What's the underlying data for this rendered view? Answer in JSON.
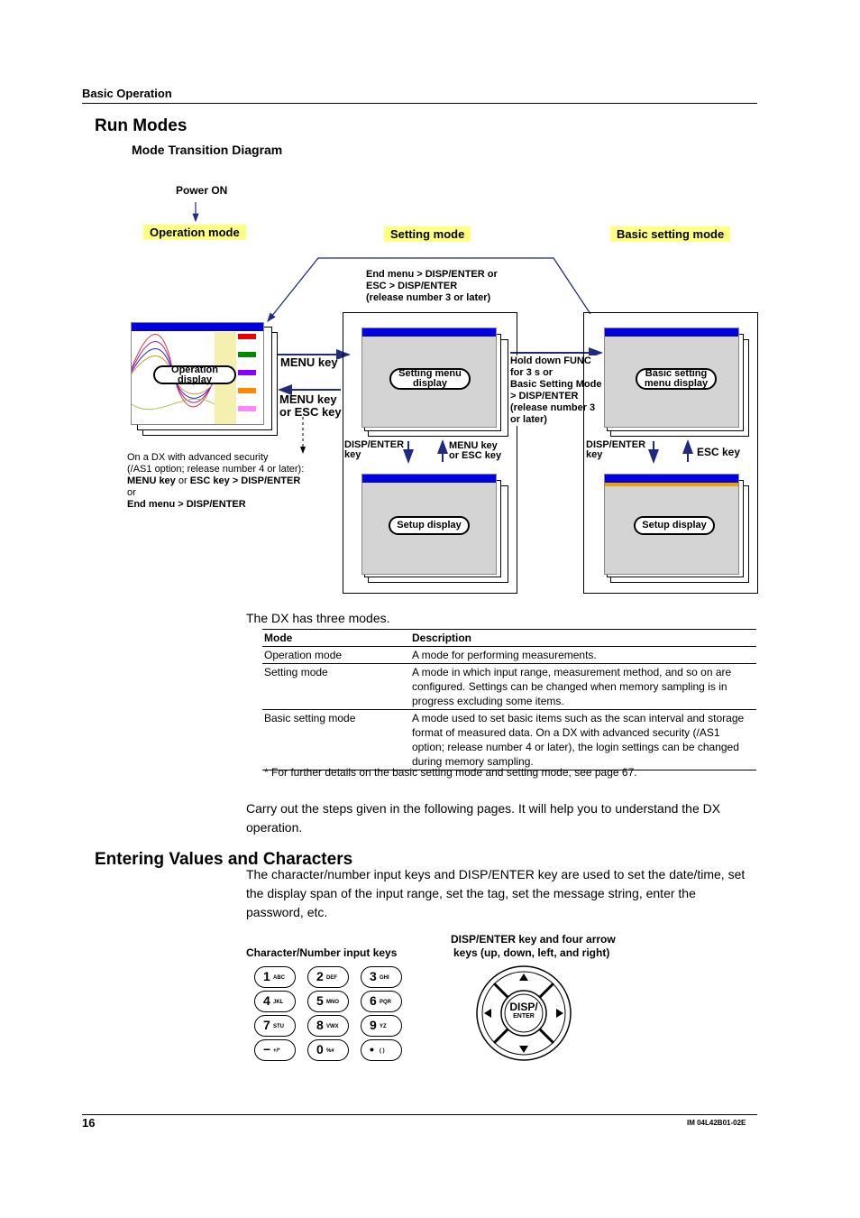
{
  "header": {
    "section": "Basic Operation"
  },
  "title": "Run Modes",
  "subtitle": "Mode Transition Diagram",
  "diagram": {
    "power_on": "Power ON",
    "modes": [
      "Operation mode",
      "Setting mode",
      "Basic setting mode"
    ],
    "return_label": [
      "End menu > DISP/ENTER or",
      "ESC > DISP/ENTER",
      "(release number 3 or later)"
    ],
    "operation_display": "Operation display",
    "setting_menu_display": "Setting menu display",
    "setup_display": "Setup display",
    "basic_setting_menu_display": "Basic setting menu display",
    "basic_setup_display": "Setup display",
    "menu_key": "MENU key",
    "menu_or_esc": [
      "MENU key",
      "or ESC key"
    ],
    "security_note": [
      "On a DX with advanced security",
      "(/AS1 option; release number 4 or later):"
    ],
    "security_keys": {
      "a": "MENU key",
      "or1": " or ",
      "b": "ESC key > DISP/ENTER",
      "or": "or",
      "c": "End menu > DISP/ENTER"
    },
    "hold_func": [
      "Hold down FUNC",
      "for 3 s or",
      "Basic Setting Mode",
      "> DISP/ENTER",
      "(release number 3",
      "or later)"
    ],
    "disp_enter_key": [
      "DISP/ENTER",
      "key"
    ],
    "menu_esc_small": [
      "MENU key",
      "or ESC key"
    ],
    "disp_enter_key2": [
      "DISP/ENTER",
      "key"
    ],
    "esc_key": "ESC key",
    "screen_colors": {
      "title_bar": "#0000e0",
      "body": "#d4d4d4",
      "mode_label_bg": "#ffff80",
      "arrow": "#1f2a80"
    }
  },
  "intro": "The DX has three modes.",
  "table": {
    "headers": [
      "Mode",
      "Description"
    ],
    "rows": [
      {
        "mode": "Operation mode",
        "desc": "A mode for performing measurements."
      },
      {
        "mode": "Setting mode",
        "desc": "A mode in which input range, measurement method, and so on are configured. Settings can be changed when memory sampling is in progress excluding some items."
      },
      {
        "mode": "Basic setting mode",
        "desc": "A mode used to set basic items such as the scan interval and storage format of measured data. On a DX with advanced security (/AS1 option; release number 4 or later), the login settings can be changed during memory sampling."
      }
    ],
    "footnote": "* For further details on the basic setting mode and setting mode, see page 67."
  },
  "carry_out": "Carry out the steps given in the following pages. It will help you to understand the DX operation.",
  "section2": {
    "title": "Entering Values and Characters",
    "body": "The character/number input keys and DISP/ENTER key are used to set the date/time, set the display span of the input range, set the tag, set the message string, enter the password, etc.",
    "keys_caption": "Character/Number input keys",
    "keys": [
      {
        "n": "1",
        "l": "ABC"
      },
      {
        "n": "2",
        "l": "DEF"
      },
      {
        "n": "3",
        "l": "GHI"
      },
      {
        "n": "4",
        "l": "JKL"
      },
      {
        "n": "5",
        "l": "MNO"
      },
      {
        "n": "6",
        "l": "PQR"
      },
      {
        "n": "7",
        "l": "STU"
      },
      {
        "n": "8",
        "l": "VWX"
      },
      {
        "n": "9",
        "l": "YZ"
      },
      {
        "n": "−",
        "l": "+/*"
      },
      {
        "n": "0",
        "l": "%#"
      },
      {
        "n": "•",
        "l": "( )"
      }
    ],
    "arrow_caption": [
      "DISP/ENTER key and four arrow",
      "keys (up, down, left, and right)"
    ],
    "center_key": [
      "DISP/",
      "ENTER"
    ]
  },
  "footer": {
    "page": "16",
    "doc_id": "IM 04L42B01-02E"
  }
}
